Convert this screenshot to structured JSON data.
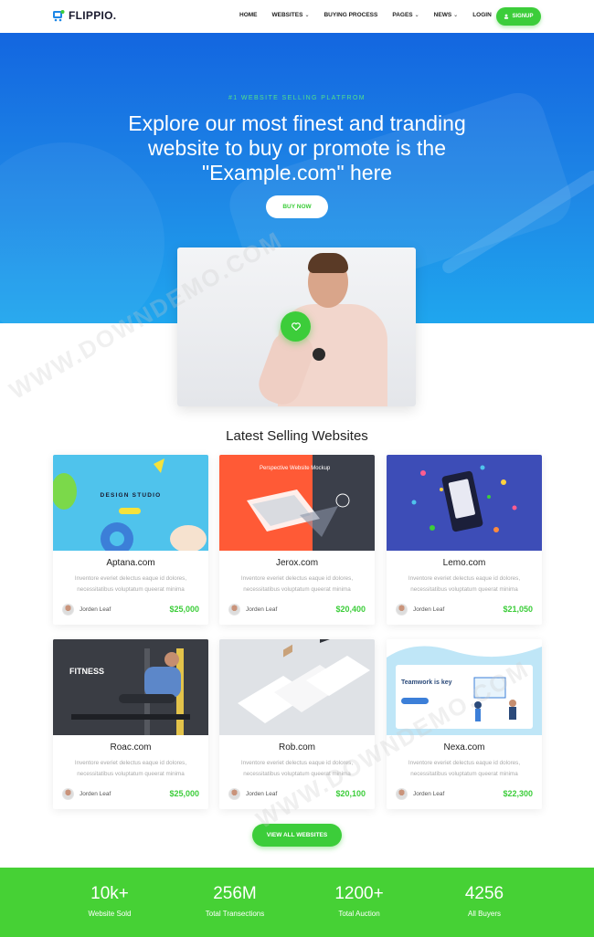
{
  "brand": {
    "name": "FLIPPIO.",
    "accent": "#3ccd3a",
    "hero_blue": "#1e87e6"
  },
  "nav": {
    "items": [
      {
        "label": "HOME",
        "dropdown": false
      },
      {
        "label": "WEBSITES",
        "dropdown": true
      },
      {
        "label": "BUYING PROCESS",
        "dropdown": false
      },
      {
        "label": "PAGES",
        "dropdown": true
      },
      {
        "label": "NEWS",
        "dropdown": true
      },
      {
        "label": "LOGIN",
        "dropdown": false
      }
    ],
    "signup_label": "SIGNUP"
  },
  "hero": {
    "tagline": "#1 WEBSITE SELLING PLATFROM",
    "title": "Explore our most finest and tranding website to buy or promote is the \"Example.com\" here",
    "button_label": "BUY NOW"
  },
  "section": {
    "title": "Latest Selling Websites"
  },
  "cards": [
    {
      "name": "Aptana.com",
      "desc": "Inventore everiet delectus eaque id dolores, necessitatibus voluptatum queerat minima",
      "author": "Jorden Leaf",
      "price": "$25,000",
      "thumb_text": "DESIGN STUDIO"
    },
    {
      "name": "Jerox.com",
      "desc": "Inventore everiet delectus eaque id dolores, necessitatibus voluptatum queerat minima",
      "author": "Jorden Leaf",
      "price": "$20,400",
      "thumb_text": "Perspective Website Mockup"
    },
    {
      "name": "Lemo.com",
      "desc": "Inventore everiet delectus eaque id dolores, necessitatibus voluptatum queerat minima",
      "author": "Jorden Leaf",
      "price": "$21,050",
      "thumb_text": ""
    },
    {
      "name": "Roac.com",
      "desc": "Inventore everiet delectus eaque id dolores, necessitatibus voluptatum queerat minima",
      "author": "Jorden Leaf",
      "price": "$25,000",
      "thumb_text": "FITNESS"
    },
    {
      "name": "Rob.com",
      "desc": "Inventore everiet delectus eaque id dolores, necessitatibus voluptatum queerat minima",
      "author": "Jorden Leaf",
      "price": "$20,100",
      "thumb_text": ""
    },
    {
      "name": "Nexa.com",
      "desc": "Inventore everiet delectus eaque id dolores, necessitatibus voluptatum queerat minima",
      "author": "Jorden Leaf",
      "price": "$22,300",
      "thumb_text": "Teamwork is key"
    }
  ],
  "view_all_label": "VIEW ALL WEBSITES",
  "stats": [
    {
      "value": "10k+",
      "label": "Website Sold"
    },
    {
      "value": "256M",
      "label": "Total Transections"
    },
    {
      "value": "1200+",
      "label": "Total Auction"
    },
    {
      "value": "4256",
      "label": "All Buyers"
    }
  ],
  "watermark": "WWW.DOWNDEMO.COM",
  "icons": {
    "logo": "cart-icon",
    "signup": "user-icon",
    "play": "heart-icon",
    "chevron": "chevron-down-icon"
  }
}
